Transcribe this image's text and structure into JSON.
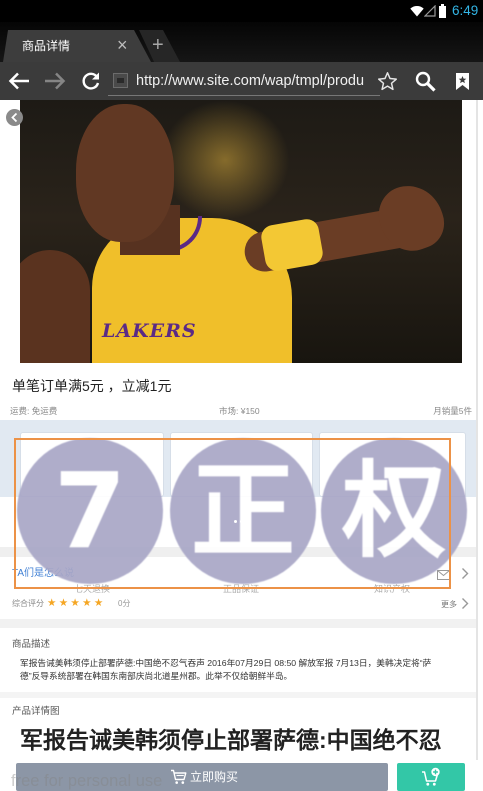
{
  "status_bar": {
    "time": "6:49",
    "time_color": "#33b5e5",
    "icons": [
      "wifi-icon",
      "signal-icon",
      "battery-icon"
    ]
  },
  "browser": {
    "tab_title": "商品详情",
    "tab_close": "×",
    "new_tab": "+",
    "url": "http://www.site.com/wap/tmpl/produ",
    "icons": [
      "arrow-left-icon",
      "arrow-right-icon",
      "refresh-icon",
      "favicon-icon",
      "star-icon",
      "search-icon",
      "bookmarks-icon"
    ]
  },
  "product": {
    "image": {
      "jersey_text": "LAKERS"
    },
    "promo_title": "单笔订单满5元 ，立减1元",
    "shipping": "运费: 免运费",
    "market_price": "市场: ¥150",
    "monthly_sales": "月销量5件",
    "guarantees": [
      "七天退换",
      "正品保证",
      "知识产权"
    ]
  },
  "overlay": {
    "circle_chars": [
      "7",
      "正",
      "权"
    ],
    "circle_color": "#a9a7c7",
    "border_color": "#ec9247"
  },
  "reviews": {
    "label": "TA们是怎么说",
    "label_color": "#3f7fd4",
    "icons": [
      "envelope-icon",
      "chevron-right-icon"
    ]
  },
  "rating": {
    "label": "综合评分",
    "stars": "★★★★★",
    "score": "0分",
    "more": "更多",
    "star_color": "#f5a623"
  },
  "description": {
    "title": "商品描述",
    "text": "军报告诫美韩须停止部署萨德:中国绝不忍气吞声 2016年07月29日 08:50 解放军报 7月13日，美韩决定将“萨德”反导系统部署在韩国东南部庆尚北道星州郡。此举不仅给朝鲜半岛。"
  },
  "detail": {
    "title": "产品详情图",
    "headline": "军报告诫美韩须停止部署萨德:中国绝不忍"
  },
  "bottom_bar": {
    "buy_label": "立即购买",
    "buy_color": "#8c96a6",
    "cart_color": "#33c7a7",
    "icons": [
      "cart-icon",
      "add-to-cart-icon"
    ]
  },
  "watermark": "free for personal use"
}
